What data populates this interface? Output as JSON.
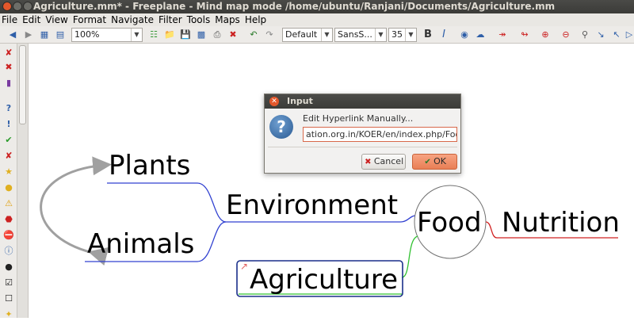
{
  "window": {
    "title": "Agriculture.mm* - Freeplane - Mind map mode /home/ubuntu/Ranjani/Documents/Agriculture.mm"
  },
  "menu": [
    "File",
    "Edit",
    "View",
    "Format",
    "Navigate",
    "Filter",
    "Tools",
    "Maps",
    "Help"
  ],
  "toolbar": {
    "zoom": "100%",
    "style": "Default",
    "font": "SansS...",
    "size": "35",
    "bold": "B",
    "italic": "I"
  },
  "map": {
    "nodes": {
      "plants": "Plants",
      "animals": "Animals",
      "environment": "Environment",
      "food": "Food",
      "nutrition": "Nutrition",
      "agriculture": "Agriculture"
    }
  },
  "dialog": {
    "title": "Input",
    "message": "Edit Hyperlink Manually...",
    "value": "ation.org.in/KOER/en/index.php/Food",
    "cancel": "Cancel",
    "ok": "OK"
  },
  "colors": {
    "edge_blue": "#3040d0",
    "edge_red": "#d02020",
    "edge_green": "#30c030",
    "connector": "#a0a0a0",
    "accent_orange": "#e97f55"
  }
}
